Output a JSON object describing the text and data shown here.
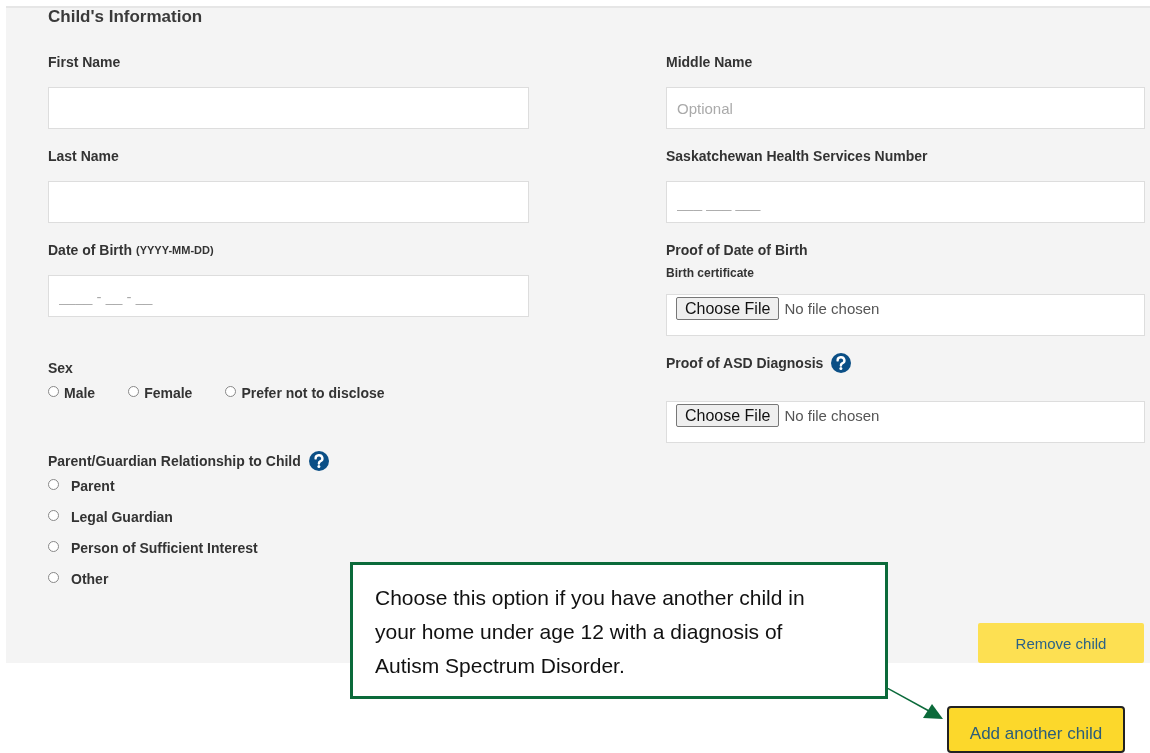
{
  "section_title": "Child's Information",
  "left_column": [
    {
      "kind": "text",
      "label": "First Name"
    },
    {
      "kind": "text",
      "label": "Last Name"
    },
    {
      "kind": "text",
      "label": "Date of Birth",
      "hint": "(YYYY-MM-DD)",
      "placeholder": "____ - __ - __"
    },
    {
      "kind": "radio_inline",
      "label": "Sex",
      "options": [
        {
          "label": "Male",
          "selected": false
        },
        {
          "label": "Female",
          "selected": false
        },
        {
          "label": "Prefer not to disclose",
          "selected": false
        }
      ]
    },
    {
      "kind": "radio_list",
      "label": "Parent/Guardian Relationship to Child",
      "help": true,
      "options": [
        {
          "label": "Parent",
          "selected": false
        },
        {
          "label": "Legal Guardian",
          "selected": false
        },
        {
          "label": "Person of Sufficient Interest",
          "selected": false
        },
        {
          "label": "Other",
          "selected": false
        }
      ]
    }
  ],
  "right_column": [
    {
      "kind": "text",
      "label": "Middle Name",
      "placeholder": "Optional"
    },
    {
      "kind": "text",
      "label": "Saskatchewan Health Services Number",
      "placeholder": "___ ___ ___"
    },
    {
      "kind": "file",
      "label": "Proof of Date of Birth",
      "sublabel": "Birth certificate",
      "button": "Choose File",
      "status": "No file chosen"
    },
    {
      "kind": "file",
      "label": "Proof of ASD Diagnosis",
      "help": true,
      "button": "Choose File",
      "status": "No file chosen"
    }
  ],
  "remove_button": "Remove child",
  "callout": "Choose this option if you have another child in your home under age 12 with a diagnosis of Autism Spectrum Disorder.",
  "add_button": "Add another child"
}
